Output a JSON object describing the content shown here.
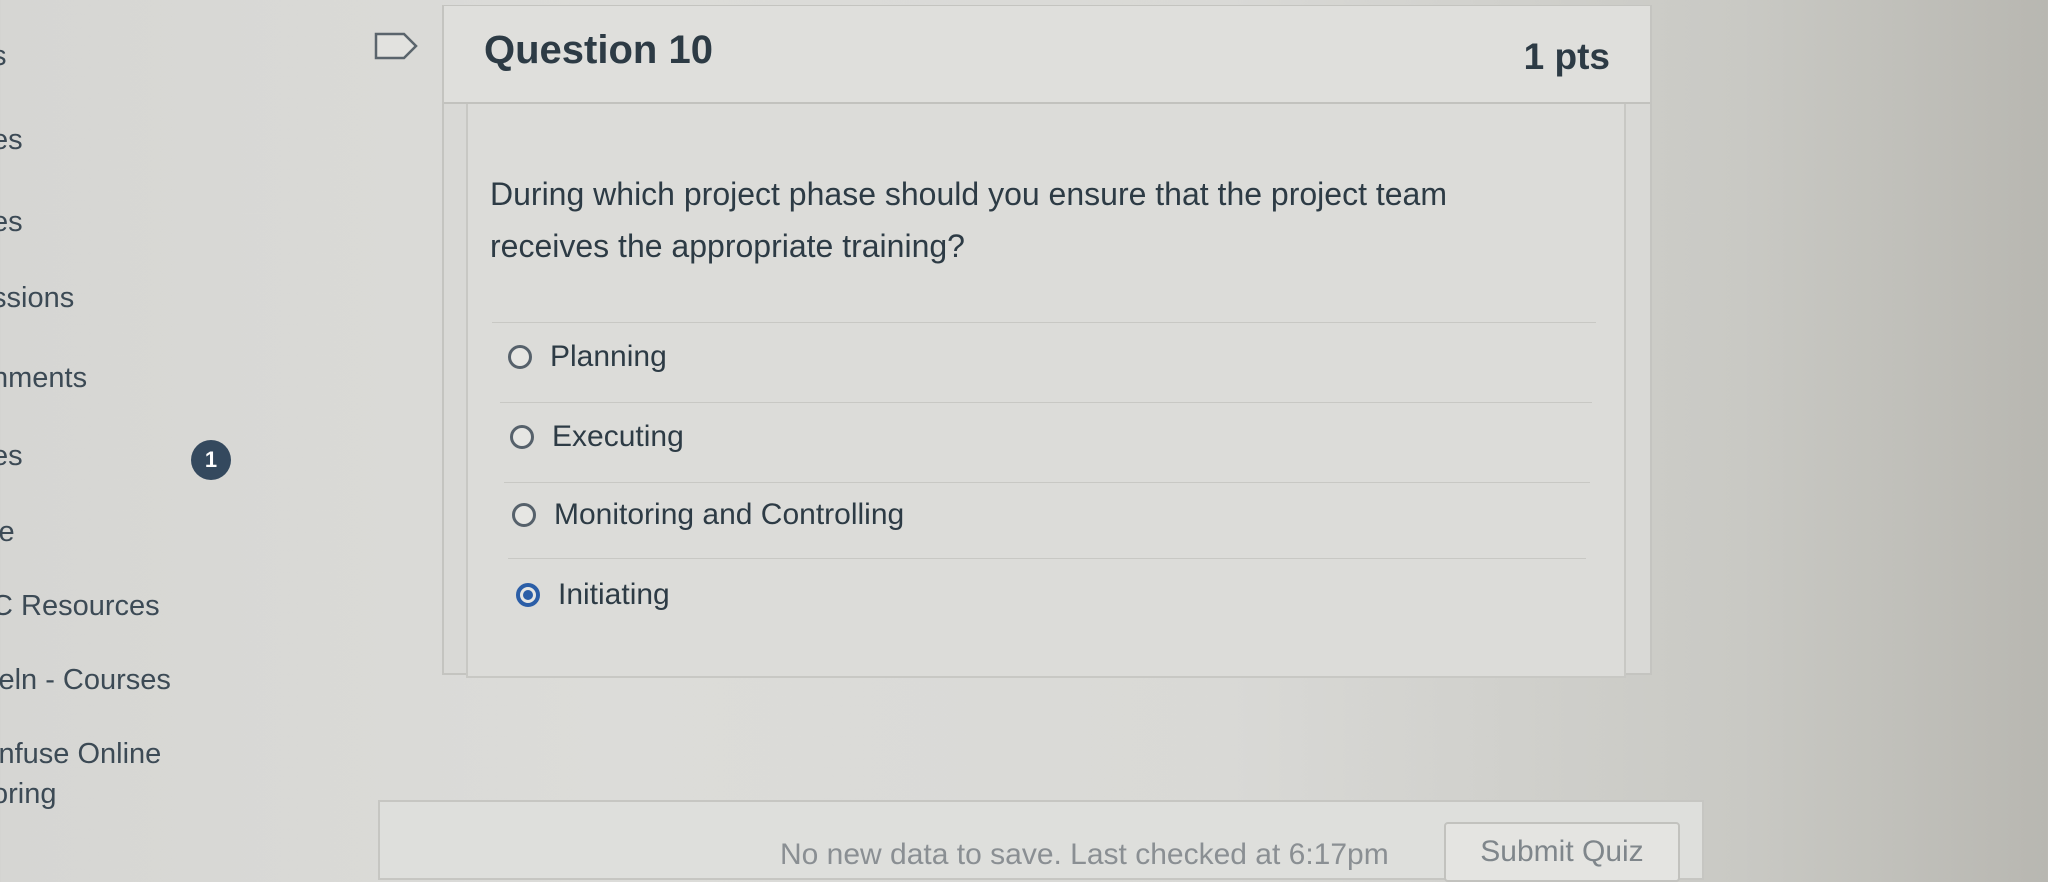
{
  "sidebar": {
    "items": [
      {
        "label": "s"
      },
      {
        "label": "es"
      },
      {
        "label": "es"
      },
      {
        "label": "ssions"
      },
      {
        "label": "nments"
      },
      {
        "label": "es"
      },
      {
        "label": "le"
      },
      {
        "label": "C Resources"
      },
      {
        "label": "leln - Courses"
      },
      {
        "label": "infuse Online"
      },
      {
        "label": "oring"
      }
    ],
    "badge_count": "1"
  },
  "question": {
    "title": "Question 10",
    "points": "1 pts",
    "text": "During which project phase should you ensure that the project team receives the appropriate training?",
    "answers": [
      {
        "label": "Planning",
        "selected": false
      },
      {
        "label": "Executing",
        "selected": false
      },
      {
        "label": "Monitoring and Controlling",
        "selected": false
      },
      {
        "label": "Initiating",
        "selected": true
      }
    ]
  },
  "footer": {
    "status_text": "No new data to save. Last checked at 6:17pm",
    "submit_label": "Submit Quiz"
  },
  "colors": {
    "accent": "#2b5ea7",
    "badge": "#34495e",
    "text": "#2d3b45"
  }
}
